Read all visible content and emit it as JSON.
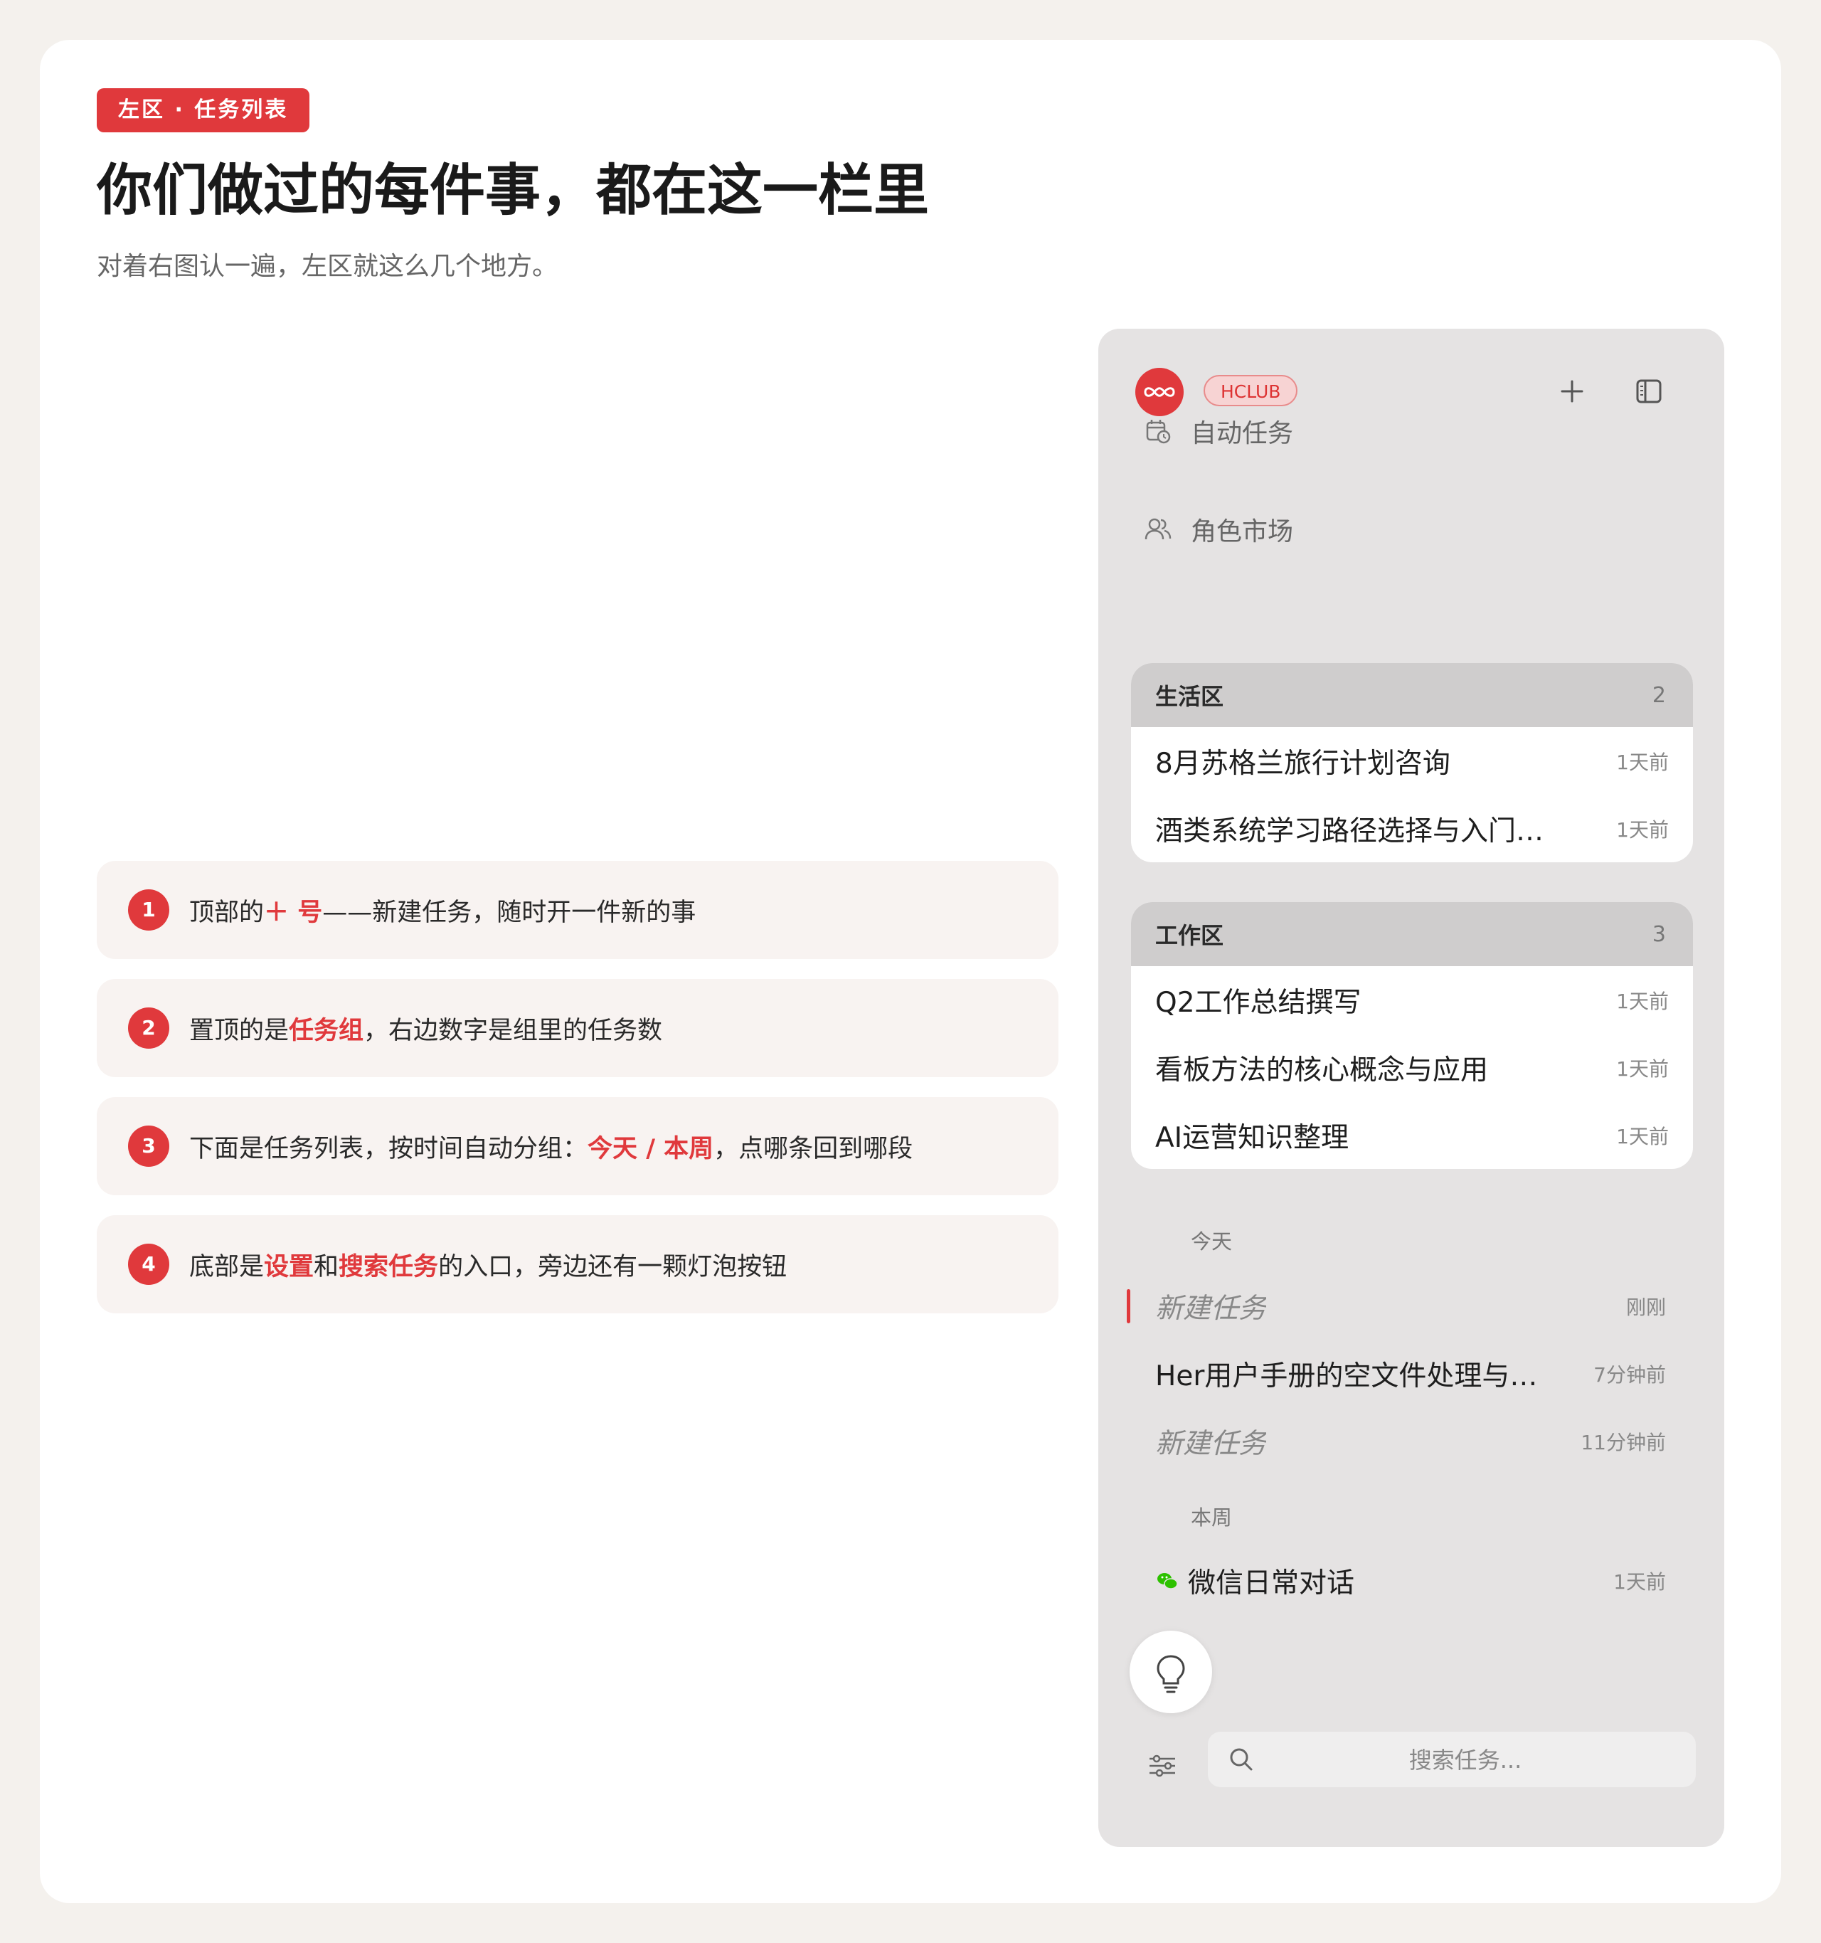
{
  "section_tag": "左区 · 任务列表",
  "title": "你们做过的每件事，都在这一栏里",
  "subtitle": "对着右图认一遍，左区就这么几个地方。",
  "notes": [
    {
      "num": "1",
      "before": "顶部的",
      "hl1": "＋ 号",
      "mid": "——新建任务，随时开一件新的事",
      "hl2": "",
      "after": ""
    },
    {
      "num": "2",
      "before": "置顶的是",
      "hl1": "任务组",
      "mid": "，右边数字是组里的任务数",
      "hl2": "",
      "after": ""
    },
    {
      "num": "3",
      "before": "下面是任务列表，按时间自动分组：",
      "hl1": "今天 / 本周",
      "mid": "，点哪条回到哪段",
      "hl2": "",
      "after": ""
    },
    {
      "num": "4",
      "before": "底部是",
      "hl1": "设置",
      "mid": "和",
      "hl2": "搜索任务",
      "after": "的入口，旁边还有一颗灯泡按钮"
    }
  ],
  "app": {
    "org_badge": "HCLUB",
    "nav": [
      {
        "label": "自动任务",
        "icon": "calendar-clock-icon"
      },
      {
        "label": "角色市场",
        "icon": "users-icon"
      }
    ],
    "groups": [
      {
        "name": "生活区",
        "count": "2",
        "tasks": [
          {
            "title": "8月苏格兰旅行计划咨询",
            "time": "1天前"
          },
          {
            "title": "酒类系统学习路径选择与入门…",
            "time": "1天前"
          }
        ]
      },
      {
        "name": "工作区",
        "count": "3",
        "tasks": [
          {
            "title": "Q2工作总结撰写",
            "time": "1天前"
          },
          {
            "title": "看板方法的核心概念与应用",
            "time": "1天前"
          },
          {
            "title": "AI运营知识整理",
            "time": "1天前"
          }
        ]
      }
    ],
    "sections": [
      {
        "label": "今天",
        "tasks": [
          {
            "title": "新建任务",
            "time": "刚刚",
            "italic": true,
            "active": true
          },
          {
            "title": "Her用户手册的空文件处理与…",
            "time": "7分钟前",
            "italic": false
          },
          {
            "title": "新建任务",
            "time": "11分钟前",
            "italic": true
          }
        ]
      },
      {
        "label": "本周",
        "tasks": [
          {
            "title": "微信日常对话",
            "time": "1天前",
            "icon": "wechat-icon"
          }
        ]
      }
    ],
    "search_placeholder": "搜索任务...",
    "colors": {
      "accent": "#e0393c",
      "wechat": "#2dc100",
      "panel_bg": "#e5e3e3"
    }
  }
}
